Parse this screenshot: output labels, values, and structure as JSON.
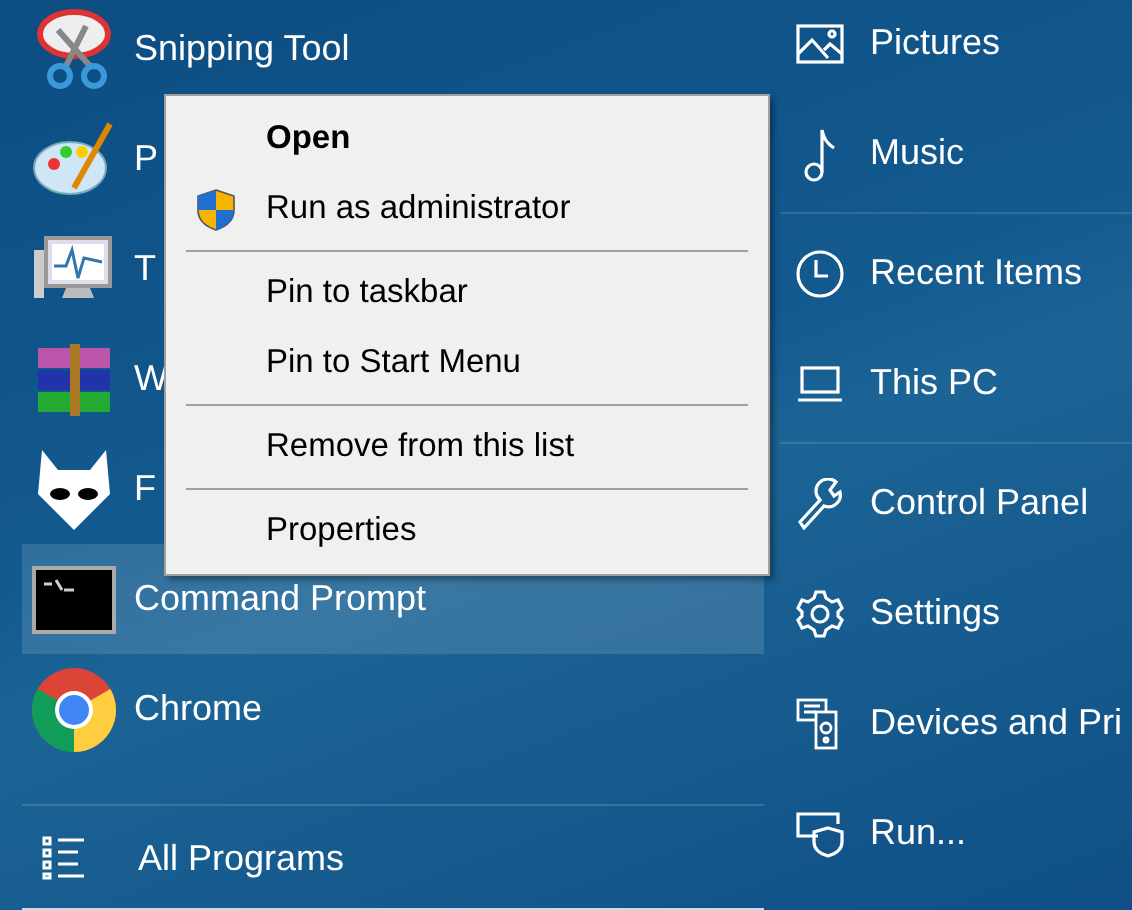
{
  "left_panel": {
    "programs": [
      {
        "label": "Snipping Tool",
        "selected": false
      },
      {
        "label": "P",
        "selected": false
      },
      {
        "label": "T",
        "selected": false
      },
      {
        "label": "W",
        "selected": false
      },
      {
        "label": "F",
        "selected": false
      },
      {
        "label": "Command Prompt",
        "selected": true
      },
      {
        "label": "Chrome",
        "selected": false
      }
    ],
    "all_programs": {
      "label": "All Programs"
    }
  },
  "right_panel": {
    "items": [
      {
        "label": "Pictures",
        "divider_after": false
      },
      {
        "label": "Music",
        "divider_after": true
      },
      {
        "label": "Recent Items",
        "divider_after": false
      },
      {
        "label": "This PC",
        "divider_after": true
      },
      {
        "label": "Control Panel",
        "divider_after": false
      },
      {
        "label": "Settings",
        "divider_after": false
      },
      {
        "label": "Devices and Pri",
        "divider_after": false
      },
      {
        "label": "Run...",
        "divider_after": false
      }
    ]
  },
  "context_menu": {
    "items": [
      {
        "kind": "item",
        "label": "Open",
        "default": true,
        "shield": false
      },
      {
        "kind": "item",
        "label": "Run as administrator",
        "default": false,
        "shield": true
      },
      {
        "kind": "separator"
      },
      {
        "kind": "item",
        "label": "Pin to taskbar",
        "default": false,
        "shield": false
      },
      {
        "kind": "item",
        "label": "Pin to Start Menu",
        "default": false,
        "shield": false
      },
      {
        "kind": "separator"
      },
      {
        "kind": "item",
        "label": "Remove from this list",
        "default": false,
        "shield": false
      },
      {
        "kind": "separator"
      },
      {
        "kind": "item",
        "label": "Properties",
        "default": false,
        "shield": false
      }
    ]
  }
}
